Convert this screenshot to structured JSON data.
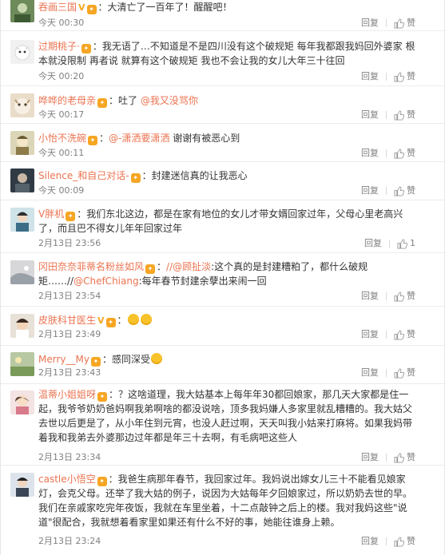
{
  "comments": [
    {
      "user": "吞画三国",
      "vip": true,
      "text": "大清亡了一百年了！醒醒吧！",
      "time": "今天 00:30",
      "reply": "回复",
      "like": "赞"
    },
    {
      "user": "过期桃子·",
      "text": "我无语了…不知道是不是四川没有这个破规矩 每年我都跟我妈回外婆家 根本就没限制 再者说 就算有这个破规矩 我也不会让我的女儿大年三十往回",
      "time": "今天 00:20",
      "reply": "回复",
      "like": "赞"
    },
    {
      "user": "哗哗的老母亲",
      "text": "吐了",
      "mention": "@我又没骂你",
      "time": "今天 00:17",
      "reply": "回复",
      "like": "赞"
    },
    {
      "user": "小怡不洗碗",
      "mention": "@-潇洒要潇洒",
      "text": "谢谢有被恶心到",
      "time": "今天 00:11",
      "reply": "回复",
      "like": "赞"
    },
    {
      "user": "Silence_和自己对话-",
      "text": "封建迷信真的让我恶心",
      "time": "今天 00:09",
      "reply": "回复",
      "like": "赞"
    },
    {
      "user": "V胖机",
      "text": "我们东北这边，都是在家有地位的女儿才带女婿回家过年，父母心里老高兴了，而且巴不得女儿年年回家过年",
      "time": "2月13日 23:56",
      "reply": "回复",
      "like": "1"
    },
    {
      "user": "冈田奈奈菲蒂名粉丝如风",
      "mention": "//@顾扯淡",
      "text": "这个真的是封建糟粕了，都什么破规矩……//",
      "mention2": "@ChefChiang",
      "text2": ":每年春节封建余孽出来闹一回",
      "time": "2月13日 23:54",
      "reply": "回复",
      "like": "赞"
    },
    {
      "user": "皮肤科甘医生",
      "vip": true,
      "text": "",
      "time": "2月13日 23:49",
      "reply": "回复",
      "like": "赞"
    },
    {
      "user": "Merry__My",
      "text": "感同深受",
      "time": "2月13日 23:43",
      "reply": "回复",
      "like": "赞"
    },
    {
      "user": "温蒂小姐姐呀",
      "text": "？这啥道理，我大姑基本上每年年30都回娘家，那几天大家都是住一起，我爷爷奶奶爸妈啊我弟啊啥的都没说啥，顶多我妈嫌人多家里就乱糟糟的。我大姑父去世以后更是了，从小年住到元宵，也没人赶过啊，天天叫我小姑来打麻将。如果我妈带着我和我弟去外婆那边过年都是年三十去啊，有毛病吧这些人",
      "time": "2月13日 23:34",
      "reply": "回复",
      "like": "赞"
    },
    {
      "user": "castle小悟空",
      "text": "我爸生病那年春节，我回家过年。我妈说出嫁女儿三十不能看见娘家灯，会克父母。还举了我大姑的例子，说因为大姑每年夕回娘家过，所以奶奶去世的早。我们在亲戚家吃完年夜饭，我就在车里坐着，十二点敲钟之后上的楼。我对我妈这些\"说道\"很配合，我就想着看家里如果还有什么不好的事，她能往谁身上赖。",
      "time": "2月13日 23:24",
      "reply": "回复",
      "like": "赞"
    }
  ]
}
